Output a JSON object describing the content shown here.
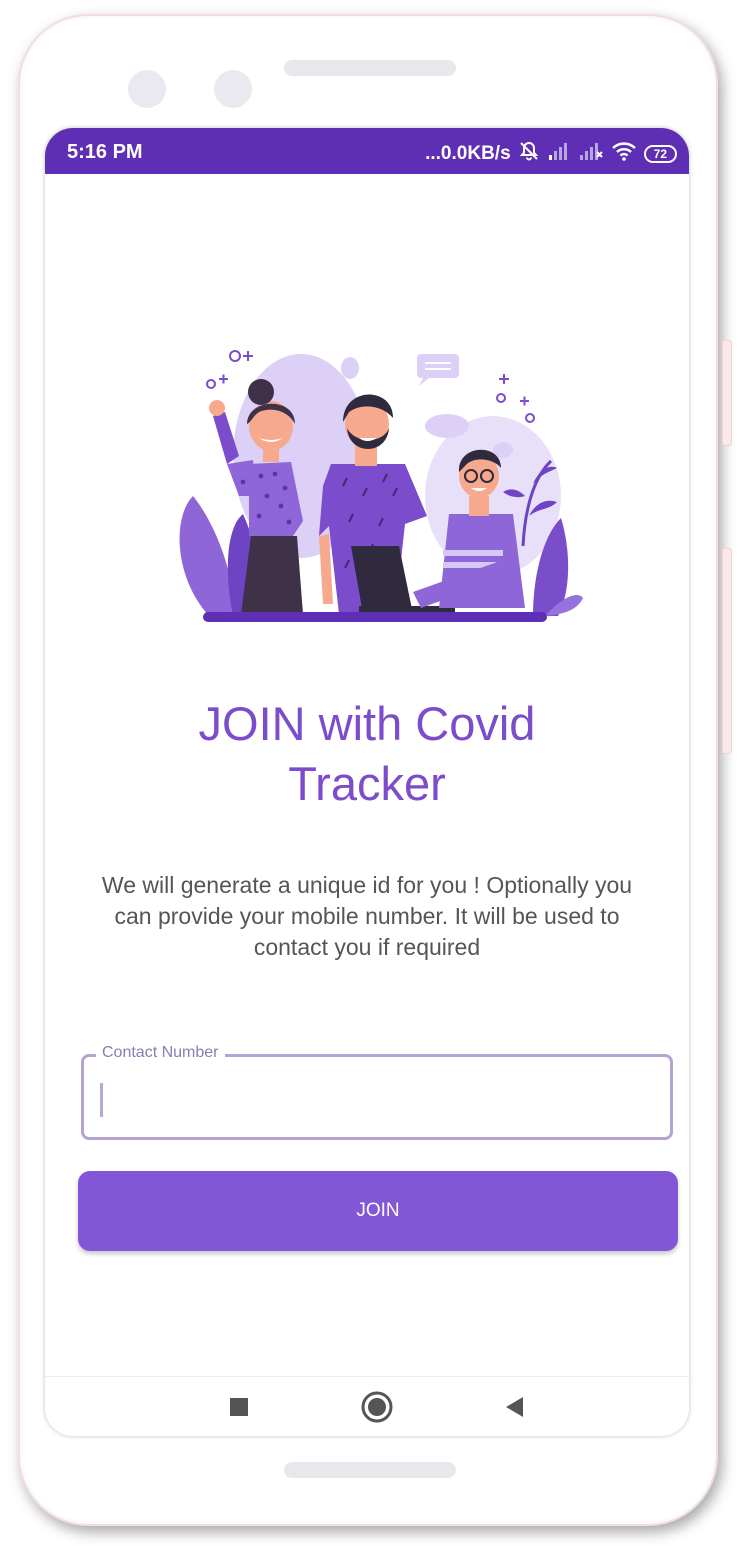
{
  "status_bar": {
    "time": "5:16 PM",
    "network_speed": "...0.0KB/s",
    "battery_level": "72",
    "icons": [
      "notifications-off-icon",
      "signal-icon",
      "signal-x-icon",
      "wifi-icon",
      "battery-icon"
    ]
  },
  "main": {
    "illustration": "people-illustration",
    "title_line1": "JOIN with Covid",
    "title_line2": "Tracker",
    "description": "We will generate a unique id for you ! Optionally you can provide your mobile number. It will be used to contact you if required"
  },
  "contact_field": {
    "label": "Contact Number",
    "value": ""
  },
  "join_button": {
    "label": "JOIN"
  },
  "nav_bar": {
    "icons": [
      "recents-square-icon",
      "home-circle-icon",
      "back-triangle-icon"
    ]
  },
  "colors": {
    "status_bar": "#5e2fb4",
    "accent": "#8356d8",
    "title": "#7b4ccc",
    "field_border": "#b4a4cf"
  }
}
